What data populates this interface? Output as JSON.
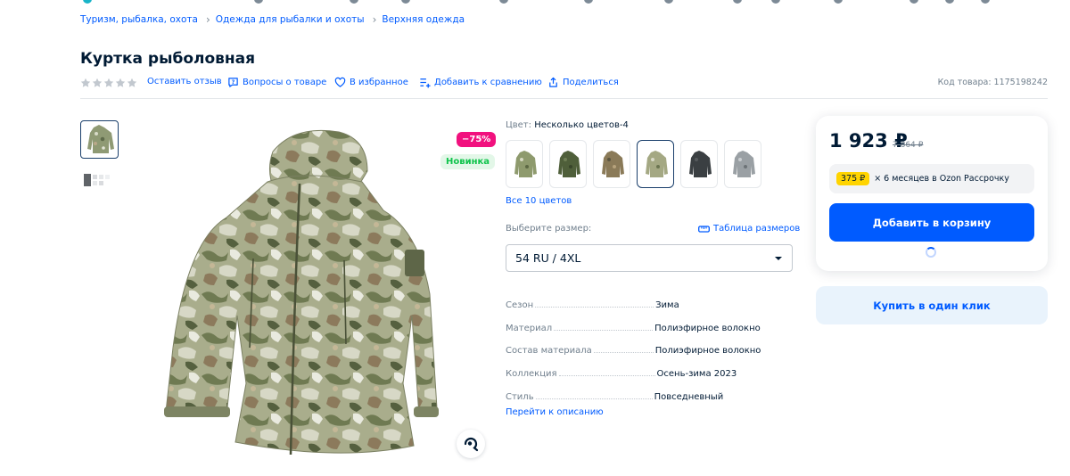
{
  "breadcrumbs": [
    "Туризм, рыбалка, охота",
    "Одежда для рыбалки и охоты",
    "Верхняя одежда"
  ],
  "product": {
    "title": "Куртка рыболовная",
    "sku": "Код товара: 1175198242"
  },
  "actions": {
    "review": "Оставить отзыв",
    "questions": "Вопросы о товаре",
    "favorites": "В избранное",
    "compare": "Добавить к сравнению",
    "share": "Поделиться"
  },
  "badges": {
    "discount": "−75%",
    "new": "Новинка"
  },
  "color": {
    "label": "Цвет:",
    "value": "Несколько цветов-4",
    "all_link": "Все 10 цветов",
    "swatch_count": 6,
    "selected_index": 3
  },
  "size": {
    "label": "Выберите размер:",
    "table_link": "Таблица размеров",
    "selected": "54 RU / 4XL"
  },
  "specs": [
    {
      "key": "Сезон",
      "value": "Зима"
    },
    {
      "key": "Материал",
      "value": "Полиэфирное волокно"
    },
    {
      "key": "Состав материала",
      "value": "Полиэфирное волокно"
    },
    {
      "key": "Коллекция",
      "value": "Осень-зима 2023"
    },
    {
      "key": "Стиль",
      "value": "Повседневный"
    }
  ],
  "to_description": "Перейти к описанию",
  "buy": {
    "price": "1 923 ₽",
    "old_price": "7 864 ₽",
    "installment_badge": "375 ₽",
    "installment_text": "× 6 месяцев в Ozon Рассрочку",
    "add_to_cart": "Добавить в корзину",
    "one_click": "Купить в один клик"
  },
  "colors": {
    "link": "#005bff",
    "primary_button": "#005bff",
    "discount_badge": "#f1117e",
    "new_badge_text": "#10c44c",
    "installment_badge": "#ffd400"
  }
}
